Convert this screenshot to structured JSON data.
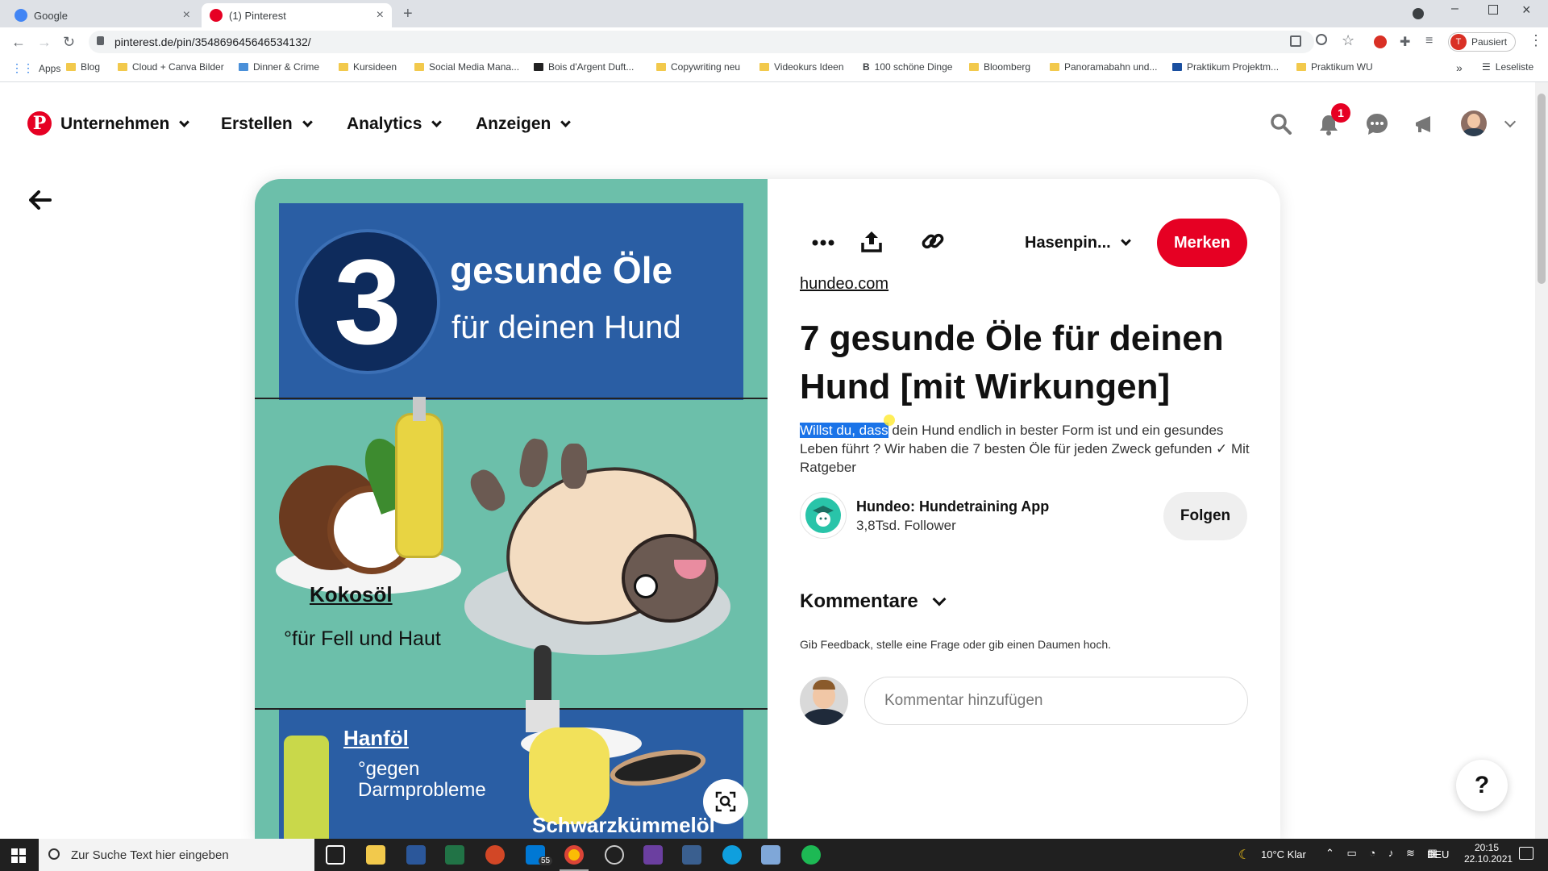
{
  "browser": {
    "tabs": [
      {
        "label": "Google",
        "favicon_color": "#4285f4"
      },
      {
        "label": "(1) Pinterest",
        "favicon_color": "#e60023"
      }
    ],
    "new_tab": "+",
    "url": "pinterest.de/pin/354869645646534132/",
    "profile_status": "Pausiert",
    "profile_initial": "T",
    "bookmarks": [
      "Apps",
      "Blog",
      "Cloud + Canva Bilder",
      "Dinner & Crime",
      "Kursideen",
      "Social Media Mana...",
      "Bois d'Argent Duft...",
      "Copywriting neu",
      "Videokurs Ideen",
      "100 schöne Dinge",
      "Bloomberg",
      "Panoramabahn und...",
      "Praktikum Projektm...",
      "Praktikum WU"
    ],
    "bookmarks_more": "»",
    "reading_list": "Leseliste"
  },
  "pinterest": {
    "nav": {
      "items": [
        "Unternehmen",
        "Erstellen",
        "Analytics",
        "Anzeigen"
      ],
      "notification_count": "1"
    },
    "pin": {
      "image_text": {
        "number": "3",
        "heading_line1": "gesunde Öle",
        "heading_line2": "für deinen Hund",
        "oil1_name": "Kokosöl",
        "oil1_benefit": "°für Fell und Haut",
        "oil2_name": "Hanföl",
        "oil2_benefit_line1": "°gegen",
        "oil2_benefit_line2": "Darmprobleme",
        "oil3_name": "Schwarzkümmelöl"
      },
      "board_select": "Hasenpin...",
      "save_label": "Merken",
      "source_link": "hundeo.com",
      "title": "7 gesunde Öle für deinen Hund [mit Wirkungen]",
      "description_highlighted": "Willst du, dass",
      "description_rest": " dein Hund endlich in bester Form ist und ein gesundes Leben führt ? Wir haben die 7 besten Öle für jeden Zweck gefunden ✓ Mit Ratgeber",
      "creator_name": "Hundeo: Hundetraining App",
      "creator_followers": "3,8Tsd. Follower",
      "follow_label": "Folgen",
      "comments_heading": "Kommentare",
      "comments_hint": "Gib Feedback, stelle eine Frage oder gib einen Daumen hoch.",
      "comment_placeholder": "Kommentar hinzufügen"
    },
    "help": "?"
  },
  "taskbar": {
    "search_placeholder": "Zur Suche Text hier eingeben",
    "mail_badge": "55",
    "weather": "10°C  Klar",
    "lang": "DEU",
    "time": "20:15",
    "date": "22.10.2021"
  },
  "colors": {
    "pinterest_red": "#e60023",
    "highlight": "#1a73e8",
    "pin_teal": "#6cbfaa",
    "pin_blue": "#2a5ea4"
  }
}
